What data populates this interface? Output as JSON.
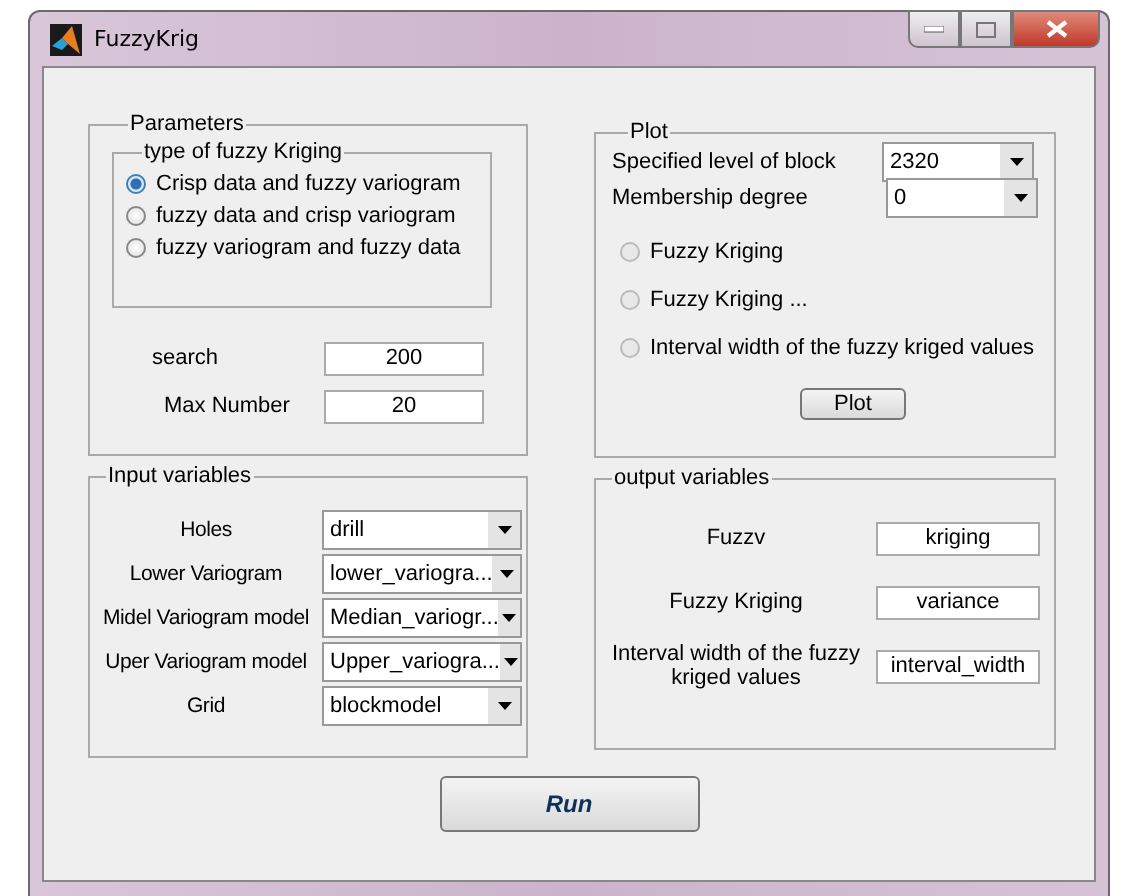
{
  "window": {
    "title": "FuzzyKrig"
  },
  "parameters": {
    "title": "Parameters",
    "group": {
      "title": "type of fuzzy Kriging",
      "options": [
        {
          "label": "Crisp data and fuzzy variogram",
          "selected": true
        },
        {
          "label": "fuzzy data and crisp variogram",
          "selected": false
        },
        {
          "label": "fuzzy variogram and fuzzy data",
          "selected": false
        }
      ]
    },
    "fields": [
      {
        "label": "search",
        "value": "200"
      },
      {
        "label": "Max Number",
        "value": "20"
      }
    ]
  },
  "plot": {
    "title": "Plot",
    "selects": [
      {
        "label": "Specified level of block",
        "value": "2320"
      },
      {
        "label": "Membership degree",
        "value": "0"
      }
    ],
    "options": [
      {
        "label": "Fuzzy Kriging",
        "selected": false,
        "disabled": true
      },
      {
        "label": "Fuzzy Kriging ...",
        "selected": false,
        "disabled": true
      },
      {
        "label": "Interval width of the fuzzy kriged values",
        "selected": false,
        "disabled": true
      }
    ],
    "button": "Plot"
  },
  "input_variables": {
    "title": "Input variables",
    "rows": [
      {
        "label": "Holes",
        "value": "drill"
      },
      {
        "label": "Lower Variogram",
        "value": "lower_variogra..."
      },
      {
        "label": "Midel Variogram model",
        "value": "Median_variogr..."
      },
      {
        "label": "Uper Variogram model",
        "value": "Upper_variogra..."
      },
      {
        "label": "Grid",
        "value": "blockmodel"
      }
    ]
  },
  "output_variables": {
    "title": "output variables",
    "rows": [
      {
        "label": "Fuzzv",
        "value": "kriging"
      },
      {
        "label": "Fuzzy Kriging",
        "value": "variance"
      },
      {
        "label": "Interval width of the fuzzy kriged values",
        "value": "interval_width"
      }
    ]
  },
  "run_button": "Run"
}
